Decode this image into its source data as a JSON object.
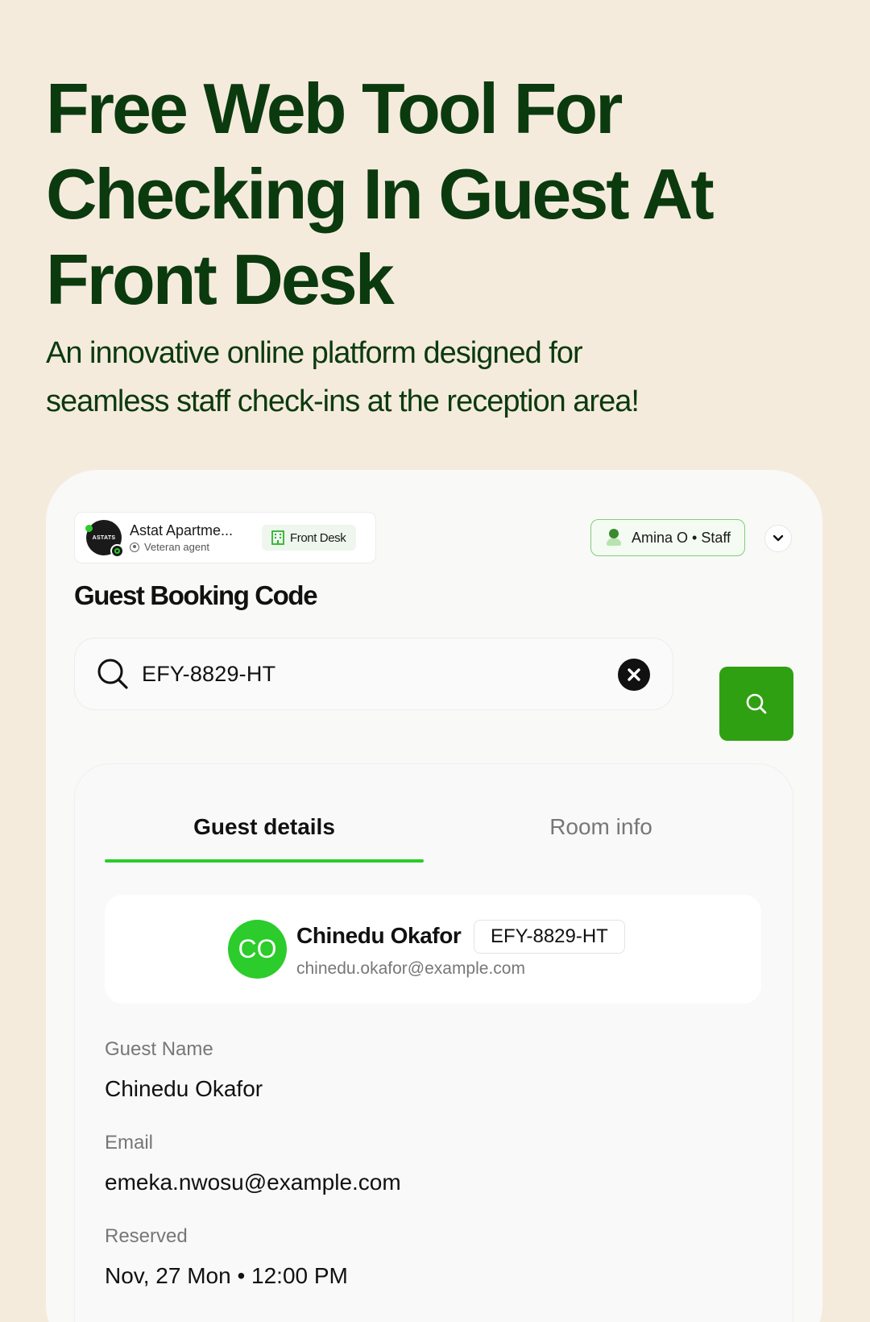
{
  "hero": {
    "title": "Free Web Tool For Checking In Guest At Front Desk",
    "subtitle": "An innovative online platform designed for seamless staff check-ins at the reception area!"
  },
  "topbar": {
    "agent_logo_text": "ASTATS",
    "agent_name": "Astat Apartme...",
    "agent_role": "Veteran agent",
    "desk_label": "Front Desk",
    "staff_label": "Amina O • Staff"
  },
  "booking": {
    "section_title": "Guest Booking Code",
    "search_value": "EFY-8829-HT"
  },
  "tabs": [
    {
      "label": "Guest details",
      "active": true
    },
    {
      "label": "Room info",
      "active": false
    }
  ],
  "guest": {
    "initials": "CO",
    "name": "Chinedu Okafor",
    "code": "EFY-8829-HT",
    "email": "chinedu.okafor@example.com"
  },
  "fields": [
    {
      "label": "Guest Name",
      "value": "Chinedu Okafor"
    },
    {
      "label": "Email",
      "value": "emeka.nwosu@example.com"
    },
    {
      "label": "Reserved",
      "value": "Nov, 27 Mon • 12:00 PM"
    }
  ],
  "colors": {
    "background": "#f5ebdd",
    "heading": "#0b3a0e",
    "accent_green": "#2bcc2b",
    "button_green": "#2fa012"
  }
}
